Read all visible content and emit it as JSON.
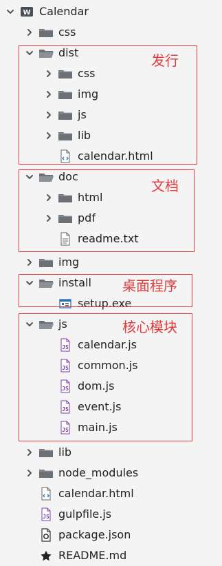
{
  "tree": [
    {
      "label": "Calendar",
      "icon": "project-icon",
      "arrow": "down"
    },
    {
      "label": "css",
      "icon": "folder-icon",
      "arrow": "right"
    },
    {
      "label": "dist",
      "icon": "folder-open-icon",
      "arrow": "down"
    },
    {
      "label": "css",
      "icon": "folder-icon",
      "arrow": "right"
    },
    {
      "label": "img",
      "icon": "folder-icon",
      "arrow": "right"
    },
    {
      "label": "js",
      "icon": "folder-icon",
      "arrow": "right"
    },
    {
      "label": "lib",
      "icon": "folder-icon",
      "arrow": "right"
    },
    {
      "label": "calendar.html",
      "icon": "html-file-icon",
      "arrow": "none"
    },
    {
      "label": "doc",
      "icon": "folder-open-icon",
      "arrow": "down"
    },
    {
      "label": "html",
      "icon": "folder-icon",
      "arrow": "right"
    },
    {
      "label": "pdf",
      "icon": "folder-icon",
      "arrow": "right"
    },
    {
      "label": "readme.txt",
      "icon": "text-file-icon",
      "arrow": "none"
    },
    {
      "label": "img",
      "icon": "folder-icon",
      "arrow": "right"
    },
    {
      "label": "install",
      "icon": "folder-open-icon",
      "arrow": "down"
    },
    {
      "label": "setup.exe",
      "icon": "exe-file-icon",
      "arrow": "none"
    },
    {
      "label": "js",
      "icon": "folder-open-icon",
      "arrow": "down"
    },
    {
      "label": "calendar.js",
      "icon": "js-file-icon",
      "arrow": "none"
    },
    {
      "label": "common.js",
      "icon": "js-file-icon",
      "arrow": "none"
    },
    {
      "label": "dom.js",
      "icon": "js-file-icon",
      "arrow": "none"
    },
    {
      "label": "event.js",
      "icon": "js-file-icon",
      "arrow": "none"
    },
    {
      "label": "main.js",
      "icon": "js-file-icon",
      "arrow": "none"
    },
    {
      "label": "lib",
      "icon": "folder-icon",
      "arrow": "right"
    },
    {
      "label": "node_modules",
      "icon": "folder-icon",
      "arrow": "right"
    },
    {
      "label": "calendar.html",
      "icon": "html-file-icon",
      "arrow": "none"
    },
    {
      "label": "gulpfile.js",
      "icon": "js-file-icon",
      "arrow": "none"
    },
    {
      "label": "package.json",
      "icon": "json-file-icon",
      "arrow": "none"
    },
    {
      "label": "README.md",
      "icon": "star-icon",
      "arrow": "none"
    }
  ],
  "annotations": [
    {
      "label": "发行"
    },
    {
      "label": "文档"
    },
    {
      "label": "桌面程序"
    },
    {
      "label": "核心模块"
    }
  ],
  "colors": {
    "annotation": "#e23b3b",
    "folder": "#6b7176",
    "js_file": "#7b3fa6",
    "html_file": "#2f7fbf"
  }
}
